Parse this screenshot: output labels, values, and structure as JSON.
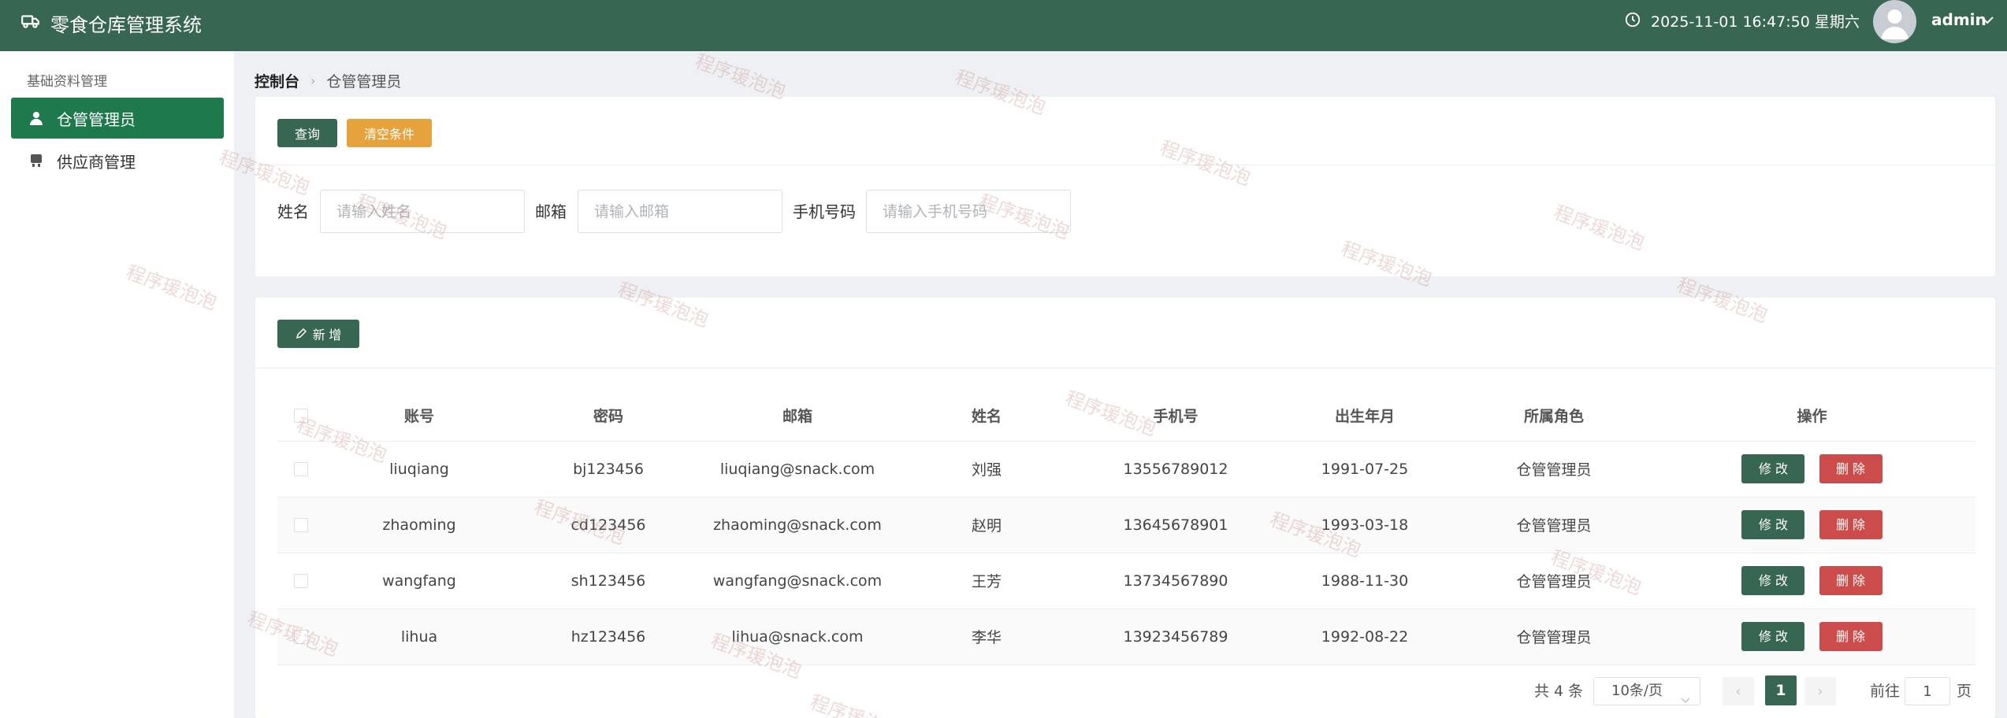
{
  "app": {
    "title": "零食仓库管理系统",
    "datetime": "2025-11-01 16:47:50 星期六",
    "username": "admin"
  },
  "sidebar": {
    "group_title": "基础资料管理",
    "items": [
      {
        "label": "仓管管理员",
        "icon": "user-icon",
        "active": true
      },
      {
        "label": "供应商管理",
        "icon": "supplier-icon",
        "active": false
      }
    ]
  },
  "breadcrumb": {
    "home": "控制台",
    "current": "仓管管理员"
  },
  "search": {
    "query_label": "查询",
    "clear_label": "清空条件",
    "fields": [
      {
        "label": "姓名",
        "placeholder": "请输入姓名"
      },
      {
        "label": "邮箱",
        "placeholder": "请输入邮箱"
      },
      {
        "label": "手机号码",
        "placeholder": "请输入手机号码"
      }
    ]
  },
  "table": {
    "add_label": "新 增",
    "columns": [
      "账号",
      "密码",
      "邮箱",
      "姓名",
      "手机号",
      "出生年月",
      "所属角色",
      "操作"
    ],
    "rows": [
      {
        "account": "liuqiang",
        "password": "bj123456",
        "email": "liuqiang@snack.com",
        "name": "刘强",
        "phone": "13556789012",
        "birth": "1991-07-25",
        "role": "仓管管理员"
      },
      {
        "account": "zhaoming",
        "password": "cd123456",
        "email": "zhaoming@snack.com",
        "name": "赵明",
        "phone": "13645678901",
        "birth": "1993-03-18",
        "role": "仓管管理员"
      },
      {
        "account": "wangfang",
        "password": "sh123456",
        "email": "wangfang@snack.com",
        "name": "王芳",
        "phone": "13734567890",
        "birth": "1988-11-30",
        "role": "仓管管理员"
      },
      {
        "account": "lihua",
        "password": "hz123456",
        "email": "lihua@snack.com",
        "name": "李华",
        "phone": "13923456789",
        "birth": "1992-08-22",
        "role": "仓管管理员"
      }
    ],
    "edit_label": "修 改",
    "delete_label": "删 除"
  },
  "pagination": {
    "total": "共 4 条",
    "page_size": "10条/页",
    "current_page": "1",
    "goto_label": "前往",
    "goto_value": "1",
    "goto_suffix": "页"
  },
  "watermark": "程序瑗泡泡",
  "colors": {
    "topbar": "#376652",
    "active_menu": "#1e7a4d",
    "primary_button": "#376652",
    "warning_button": "#e6a23c",
    "danger_button": "#cc4b4b"
  }
}
